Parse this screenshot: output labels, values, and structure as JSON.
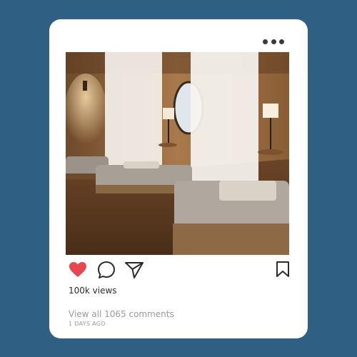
{
  "post": {
    "views": "100k views",
    "comments_link": "View all 1065 comments",
    "timestamp": "1 DAYS AGO",
    "liked": true
  },
  "icons": {
    "more": "more-horizontal-icon",
    "like": "heart-icon",
    "comment": "comment-bubble-icon",
    "share": "paper-plane-icon",
    "save": "bookmark-icon"
  },
  "colors": {
    "background": "#2f5f82",
    "card": "#ffffff",
    "like_active": "#e8464f",
    "icon": "#2b2b2b",
    "muted_text": "#9a9a9a"
  }
}
